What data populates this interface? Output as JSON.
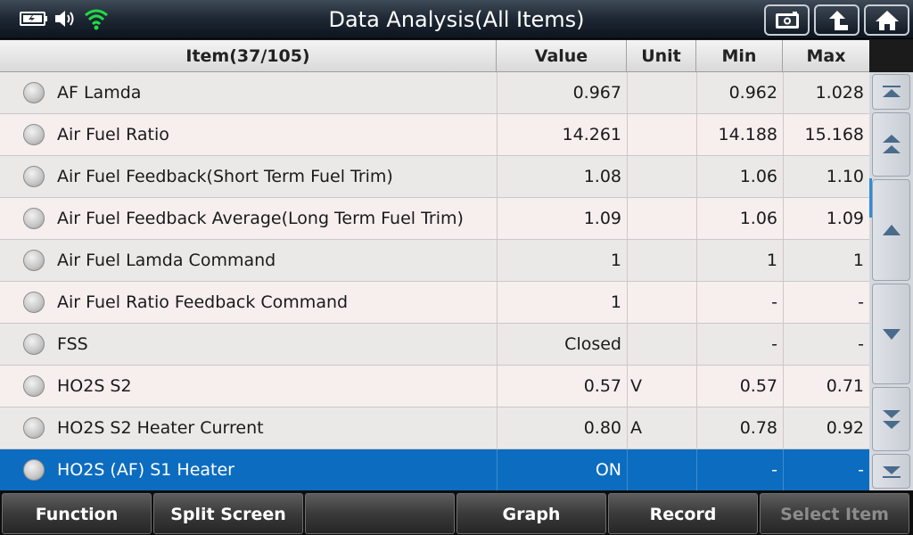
{
  "header": {
    "title": "Data Analysis(All Items)"
  },
  "columns": {
    "item": "Item(37/105)",
    "value": "Value",
    "unit": "Unit",
    "min": "Min",
    "max": "Max"
  },
  "rows": [
    {
      "name": "AF Lamda",
      "value": "0.967",
      "unit": "",
      "min": "0.962",
      "max": "1.028"
    },
    {
      "name": "Air Fuel Ratio",
      "value": "14.261",
      "unit": "",
      "min": "14.188",
      "max": "15.168"
    },
    {
      "name": "Air Fuel Feedback(Short Term Fuel Trim)",
      "value": "1.08",
      "unit": "",
      "min": "1.06",
      "max": "1.10"
    },
    {
      "name": "Air Fuel Feedback Average(Long Term Fuel Trim)",
      "value": "1.09",
      "unit": "",
      "min": "1.06",
      "max": "1.09"
    },
    {
      "name": "Air Fuel Lamda Command",
      "value": "1",
      "unit": "",
      "min": "1",
      "max": "1"
    },
    {
      "name": "Air Fuel Ratio Feedback Command",
      "value": "1",
      "unit": "",
      "min": "-",
      "max": "-"
    },
    {
      "name": "FSS",
      "value": "Closed",
      "unit": "",
      "min": "-",
      "max": "-"
    },
    {
      "name": "HO2S S2",
      "value": "0.57",
      "unit": "V",
      "min": "0.57",
      "max": "0.71"
    },
    {
      "name": "HO2S S2 Heater Current",
      "value": "0.80",
      "unit": "A",
      "min": "0.78",
      "max": "0.92"
    },
    {
      "name": "HO2S (AF) S1 Heater",
      "value": "ON",
      "unit": "",
      "min": "-",
      "max": "-"
    }
  ],
  "bottom_buttons": {
    "function": "Function",
    "split_screen": "Split Screen",
    "blank": "",
    "graph": "Graph",
    "record": "Record",
    "select_item": "Select Item"
  },
  "colors": {
    "selected_row": "#0c6cc0",
    "wifi": "#22dd44",
    "scroll_indicator": "#2f8cd8"
  }
}
